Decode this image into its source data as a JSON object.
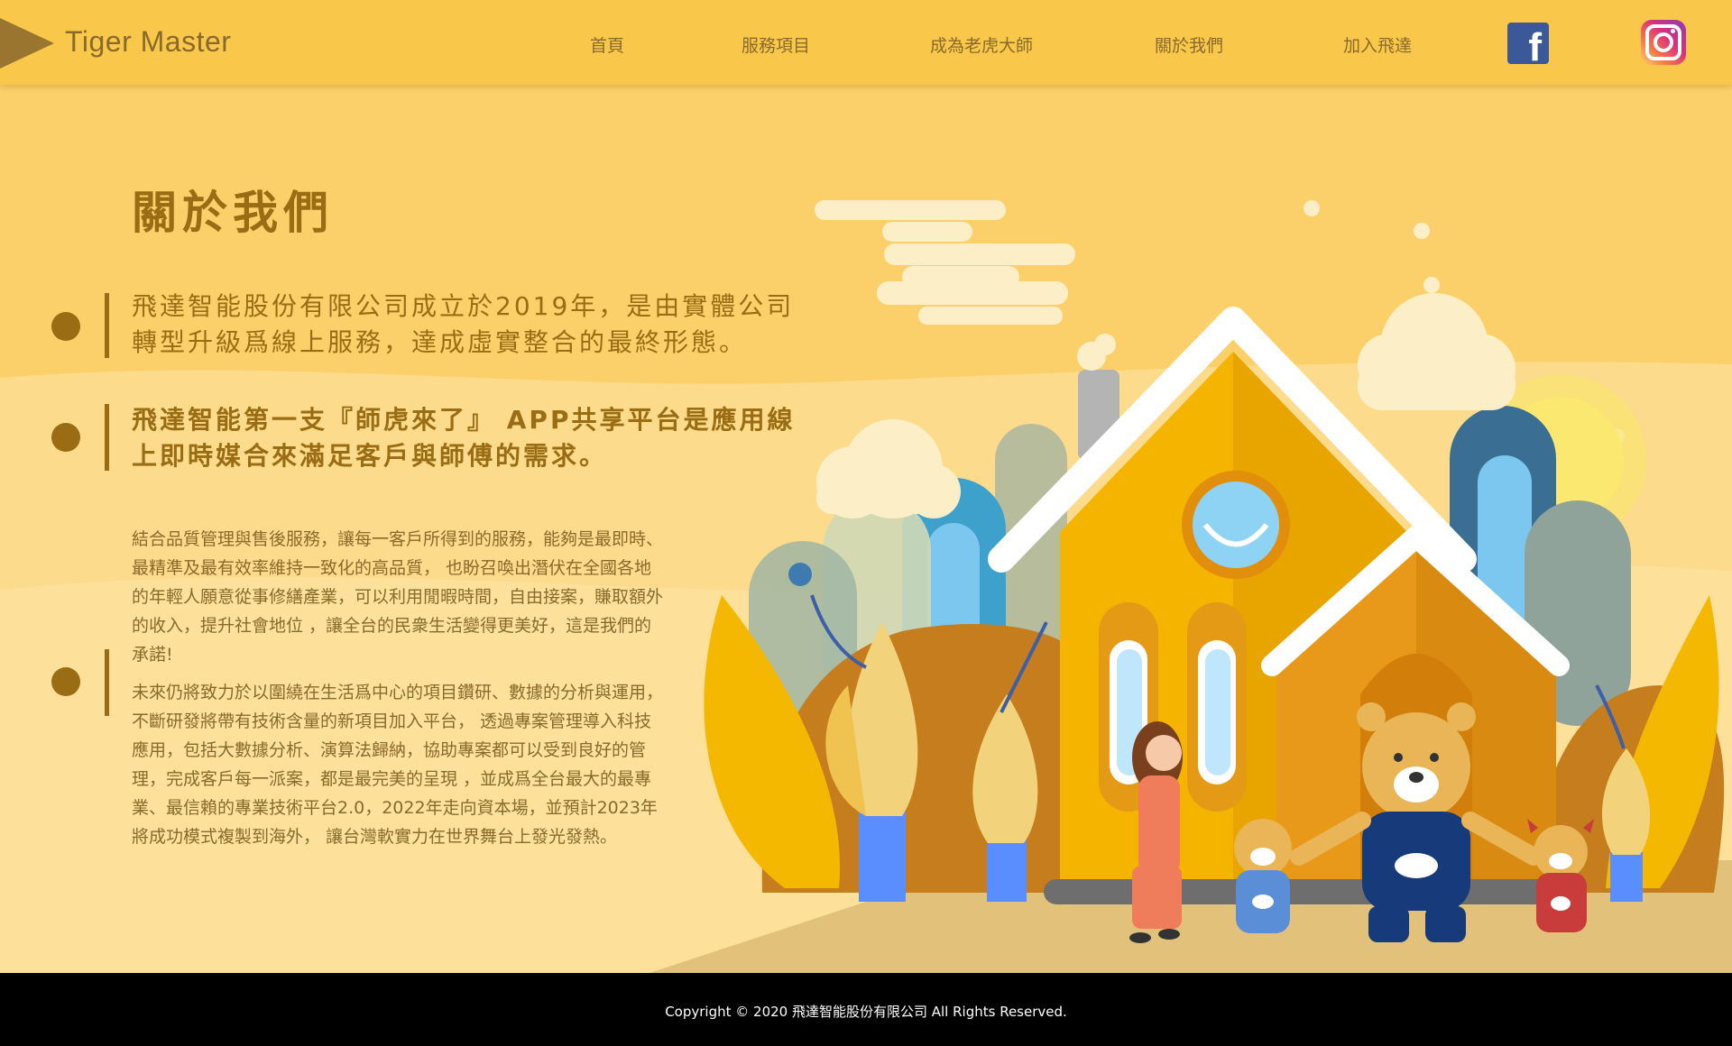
{
  "header": {
    "brand": "Tiger Master",
    "nav": [
      "首頁",
      "服務項目",
      "成為老虎大師",
      "關於我們",
      "加入飛達"
    ],
    "facebook_icon": "facebook-icon",
    "instagram_icon": "instagram-icon"
  },
  "main": {
    "title": "關於我們",
    "lead1": "飛達智能股份有限公司成立於2019年，是由實體公司轉型升級爲線上服務，達成虛實整合的最終形態。",
    "lead2": "飛達智能第一支『師虎來了』 APP共享平台是應用線上即時媒合來滿足客戶與師傅的需求。",
    "para1": "結合品質管理與售後服務，讓每一客戶所得到的服務，能夠是最即時、最精準及最有效率維持一致化的高品質， 也盼召喚出潛伏在全國各地的年輕人願意從事修繕產業，可以利用閒暇時間，自由接案，賺取額外的收入，提升社會地位 ，讓全台的民衆生活變得更美好，這是我們的承諾!",
    "para2": "未來仍將致力於以圍繞在生活爲中心的項目鑽研、數據的分析與運用，不斷研發將帶有技術含量的新項目加入平台， 透過專案管理導入科技應用，包括大數據分析、演算法歸納，協助專案都可以受到良好的管理，完成客戶每一派案，都是最完美的呈現 ，並成爲全台最大的最專業、最信賴的專業技術平台2.0，2022年走向資本場，並預計2023年將成功模式複製到海外， 讓台灣軟實力在世界舞台上發光發熱。"
  },
  "footer": {
    "copyright": "Copyright © 2020 飛達智能股份有限公司 All Rights Reserved."
  },
  "colors": {
    "header_bg": "#f9c84b",
    "accent_brown": "#9a6c14",
    "footer_bg": "#000000"
  }
}
